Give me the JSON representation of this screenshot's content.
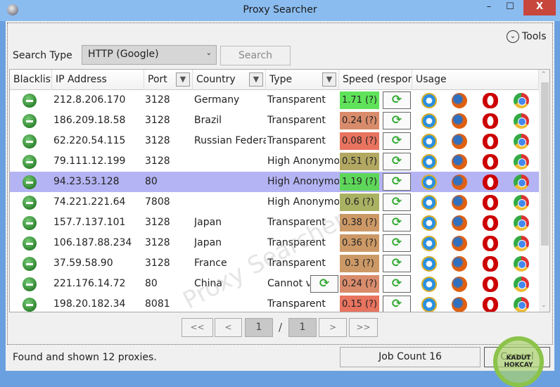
{
  "window": {
    "title": "Proxy Searcher",
    "minimize": "–",
    "maximize": "☐",
    "close": "X"
  },
  "toolbar": {
    "tools_label": "Tools",
    "search_type_label": "Search Type",
    "search_type_value": "HTTP (Google)",
    "search_label": "Search"
  },
  "table": {
    "columns": [
      "Blacklist",
      "IP Address",
      "Port",
      "Country",
      "Type",
      "Speed (respons",
      "Usage"
    ],
    "rows": [
      {
        "ip": "212.8.206.170",
        "port": "3128",
        "country": "Germany",
        "type": "Transparent",
        "speed": "1.71 (?)",
        "color": "#5fe35a"
      },
      {
        "ip": "186.209.18.58",
        "port": "3128",
        "country": "Brazil",
        "type": "Transparent",
        "speed": "0.24 (?)",
        "color": "#d98c6c"
      },
      {
        "ip": "62.220.54.115",
        "port": "3128",
        "country": "Russian Federation",
        "type": "Transparent",
        "speed": "0.08 (?)",
        "color": "#e8735f"
      },
      {
        "ip": "79.111.12.199",
        "port": "3128",
        "country": "",
        "type": "High Anonymous",
        "speed": "0.51 (?)",
        "color": "#b2a862"
      },
      {
        "ip": "94.23.53.128",
        "port": "80",
        "country": "",
        "type": "High Anonymous",
        "speed": "1.19 (?)",
        "color": "#5ed65a",
        "selected": true
      },
      {
        "ip": "74.221.221.64",
        "port": "7808",
        "country": "",
        "type": "High Anonymous",
        "speed": "0.6 (?)",
        "color": "#a9b262"
      },
      {
        "ip": "157.7.137.101",
        "port": "3128",
        "country": "Japan",
        "type": "Transparent",
        "speed": "0.38 (?)",
        "color": "#cc9966"
      },
      {
        "ip": "106.187.88.234",
        "port": "3128",
        "country": "Japan",
        "type": "Transparent",
        "speed": "0.36 (?)",
        "color": "#cc9966"
      },
      {
        "ip": "37.59.58.90",
        "port": "3128",
        "country": "France",
        "type": "Transparent",
        "speed": "0.3 (?)",
        "color": "#cc9966"
      },
      {
        "ip": "221.176.14.72",
        "port": "80",
        "country": "China",
        "type": "Cannot verify",
        "speed": "0.24 (?)",
        "color": "#d98c6c",
        "type_refresh": true
      },
      {
        "ip": "198.20.182.34",
        "port": "8081",
        "country": "",
        "type": "Transparent",
        "speed": "0.15 (?)",
        "color": "#e8735f"
      }
    ]
  },
  "pagination": {
    "first": "<<",
    "prev": "<",
    "current": "1",
    "separator": "/",
    "total": "1",
    "next": ">",
    "last": ">>"
  },
  "status": {
    "text": "Found and shown 12 proxies.",
    "job_count": "Job Count 16",
    "cancel": "Cancel"
  },
  "watermark": "Proxy Searcher",
  "stamp": "KADUT HOKCAY"
}
